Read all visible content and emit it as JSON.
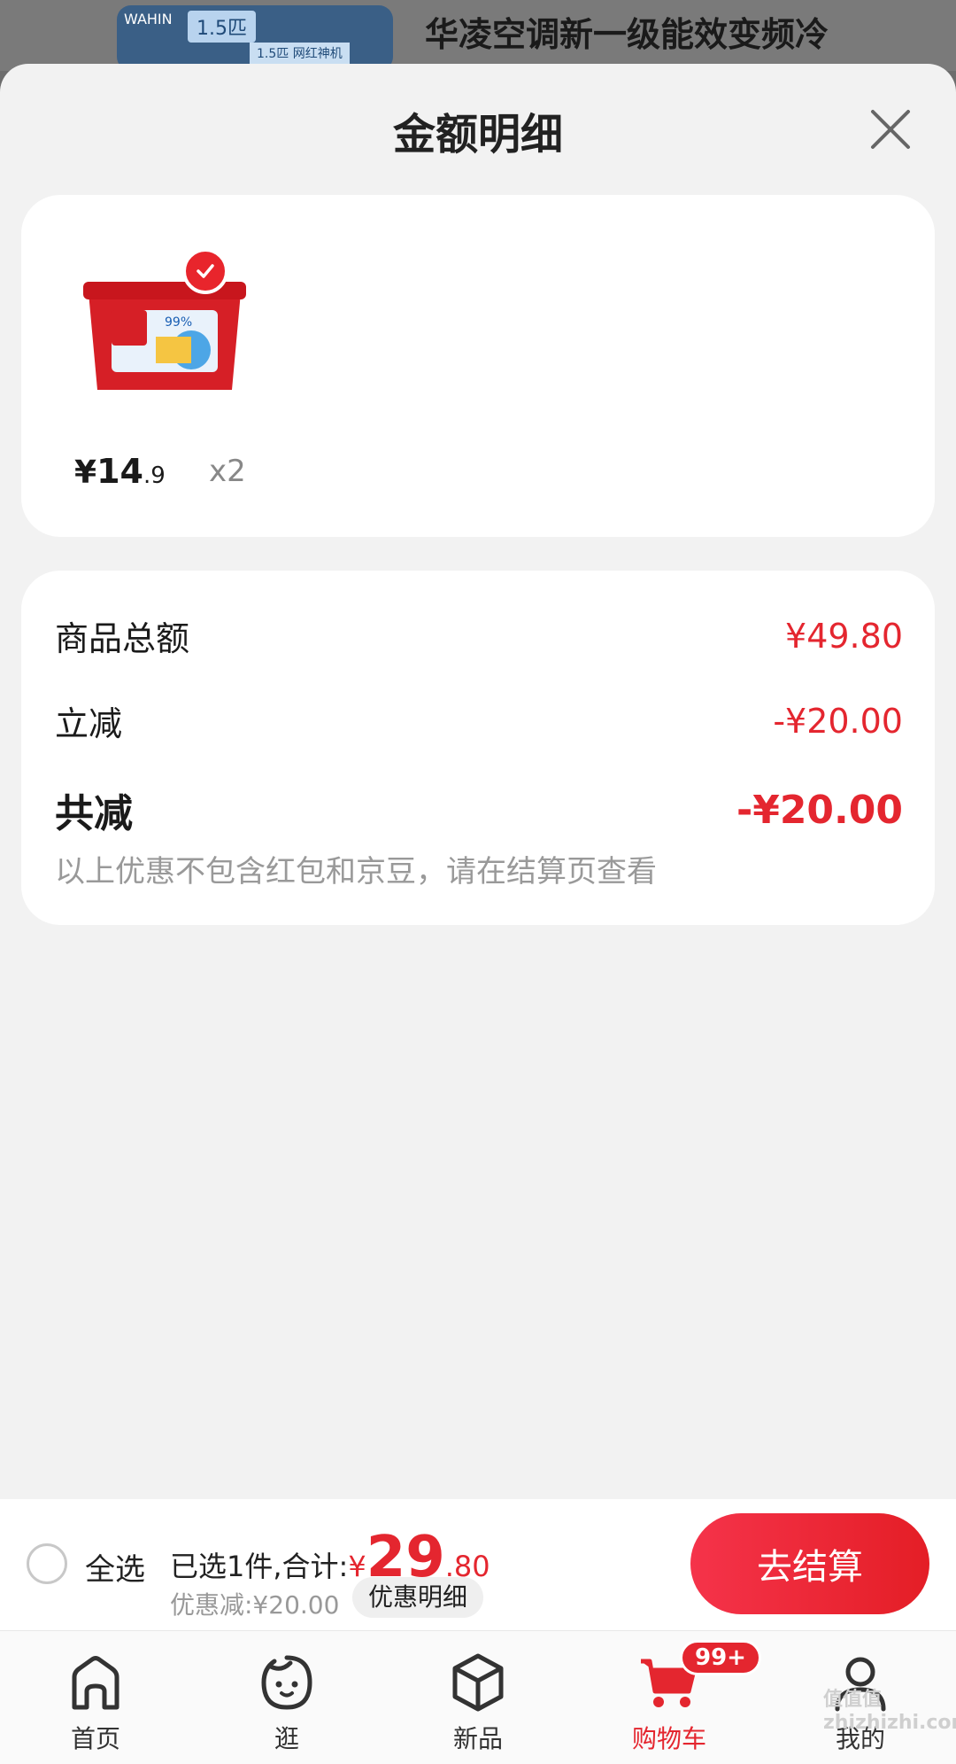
{
  "background": {
    "thumb_brand": "WAHIN",
    "thumb_tag1": "1.5匹",
    "thumb_tag2": "1.5匹 网红神机",
    "title": "华凌空调新一级能效变频冷"
  },
  "sheet": {
    "title": "金额明细",
    "close_icon": "close-icon"
  },
  "item": {
    "price_symbol": "¥",
    "price_int": "14",
    "price_dec": ".9",
    "quantity": "x2",
    "selected": true
  },
  "breakdown": {
    "goods_total_label": "商品总额",
    "goods_total_value": "¥49.80",
    "instant_cut_label": "立减",
    "instant_cut_value": "-¥20.00",
    "total_cut_label": "共减",
    "total_cut_value": "-¥20.00",
    "note": "以上优惠不包含红包和京豆，请在结算页查看"
  },
  "checkout": {
    "select_all": "全选",
    "summary_text": "已选1件,合计:",
    "currency": "¥",
    "total_int": "29",
    "total_dec": ".80",
    "discount_text": "优惠减:¥20.00",
    "detail_button": "优惠明细",
    "pay_button": "去结算"
  },
  "tabbar": {
    "home": "首页",
    "browse": "逛",
    "new": "新品",
    "cart": "购物车",
    "mine": "我的",
    "cart_badge": "99+"
  },
  "watermark": "值值值 zhizhizhi.com",
  "colors": {
    "accent": "#e4262f",
    "sheet_bg": "#f2f2f2",
    "card_bg": "#ffffff"
  }
}
